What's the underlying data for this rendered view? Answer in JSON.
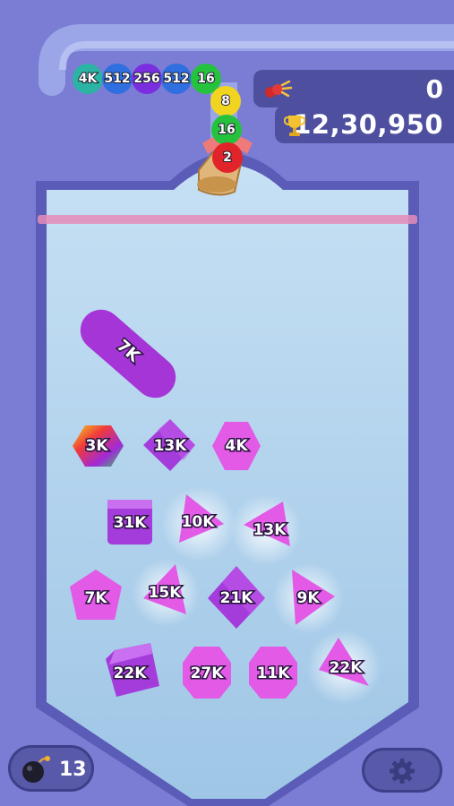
{
  "hud": {
    "score": "0",
    "best_score": "12,30,950"
  },
  "bomb": {
    "count": "13"
  },
  "queue": {
    "balls": [
      {
        "label": "4K",
        "color": "#2bb3a4"
      },
      {
        "label": "512",
        "color": "#2f6fe0"
      },
      {
        "label": "256",
        "color": "#7a2ee0"
      },
      {
        "label": "512",
        "color": "#2f6fe0"
      },
      {
        "label": "16",
        "color": "#25c23e"
      },
      {
        "label": "8",
        "color": "#f0d420"
      },
      {
        "label": "16",
        "color": "#25c23e"
      },
      {
        "label": "2",
        "color": "#e0242a"
      }
    ]
  },
  "board": {
    "pieces": [
      {
        "label": "7K"
      },
      {
        "label": "3K"
      },
      {
        "label": "13K"
      },
      {
        "label": "4K"
      },
      {
        "label": "31K"
      },
      {
        "label": "10K"
      },
      {
        "label": "13K"
      },
      {
        "label": "7K"
      },
      {
        "label": "15K"
      },
      {
        "label": "21K"
      },
      {
        "label": "9K"
      },
      {
        "label": "22K"
      },
      {
        "label": "27K"
      },
      {
        "label": "11K"
      },
      {
        "label": "22K"
      }
    ]
  },
  "colors": {
    "background": "#7b7dd4",
    "board_fill": "#b6d6ef",
    "piece_purple": "#b33ae0",
    "piece_magenta": "#e25ae6",
    "deadline": "#e58cb8"
  }
}
